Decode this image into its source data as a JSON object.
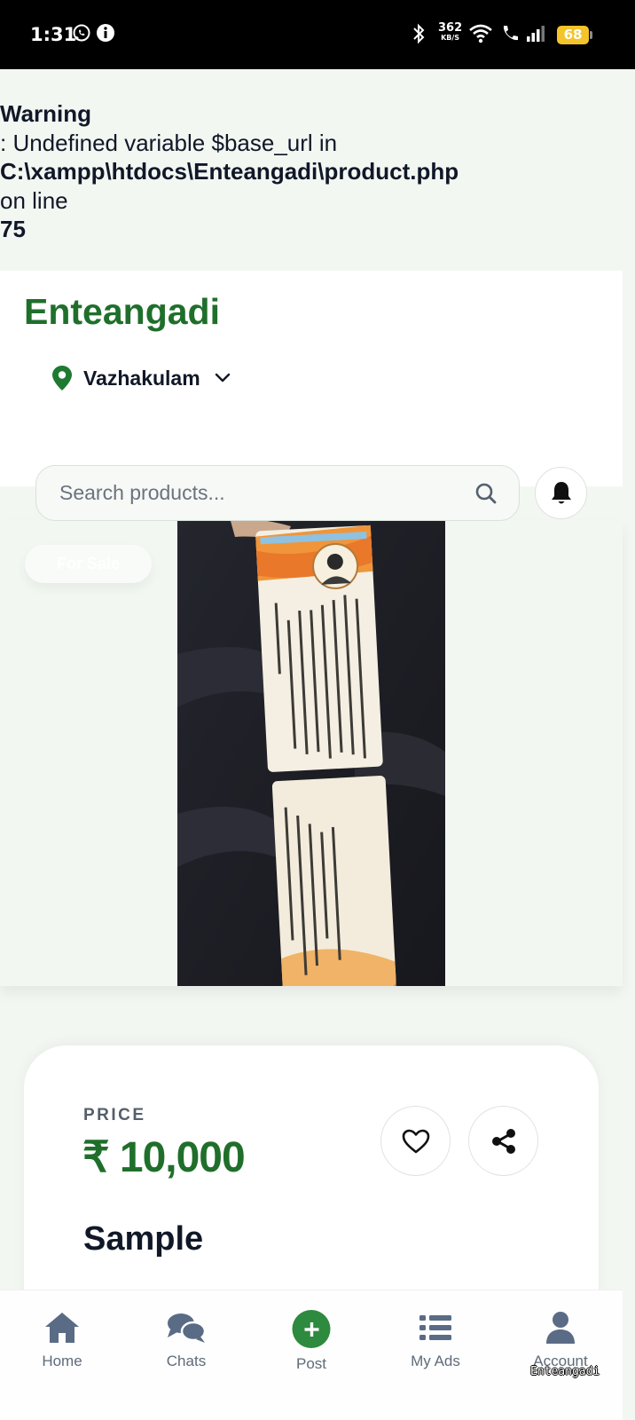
{
  "status_bar": {
    "time": "1:31",
    "network_speed": "362",
    "network_unit": "KB/S",
    "battery": "68"
  },
  "warning": {
    "label": "Warning",
    "message": ": Undefined variable $base_url in",
    "file": "C:\\xampp\\htdocs\\Enteangadi\\product.php",
    "on_line": "on line",
    "line_number": "75"
  },
  "header": {
    "brand": "Enteangadi",
    "location": "Vazhakulam"
  },
  "search": {
    "placeholder": "Search products..."
  },
  "gallery": {
    "badge": "For Sale"
  },
  "product": {
    "price_label": "PRICE",
    "price": "₹ 10,000",
    "title": "Sample"
  },
  "nav": {
    "home": "Home",
    "chats": "Chats",
    "post": "Post",
    "my_ads": "My Ads",
    "account": "Account"
  },
  "watermark": "Enteangadi",
  "colors": {
    "brand_green": "#1f6f2b",
    "post_green": "#2e8a3e",
    "nav_icon": "#5a6b85"
  }
}
